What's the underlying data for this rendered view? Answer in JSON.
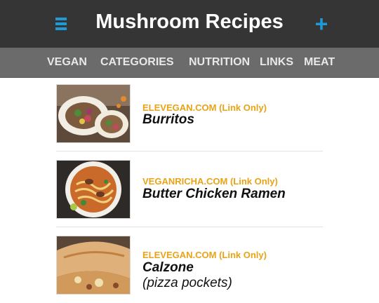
{
  "header": {
    "menu_icon": "hamburger-menu-icon",
    "title": "Mushroom Recipes",
    "add_label": "+",
    "accent_color": "#1e9bd7"
  },
  "nav": {
    "items": [
      "VEGAN",
      "CATEGORIES",
      "NUTRITION",
      "LINKS",
      "MEAT"
    ]
  },
  "recipes": [
    {
      "source": "ELEVEGAN.COM (Link Only)",
      "name": "Burritos",
      "note": ""
    },
    {
      "source": "VEGANRICHA.COM (Link Only)",
      "name": "Butter Chicken Ramen",
      "note": ""
    },
    {
      "source": "ELEVEGAN.COM (Link Only)",
      "name": "Calzone",
      "note": "(pizza pockets)"
    }
  ],
  "colors": {
    "header_bg": "#353535",
    "nav_bg": "#6b6b6b",
    "source_text": "#e8a316"
  }
}
